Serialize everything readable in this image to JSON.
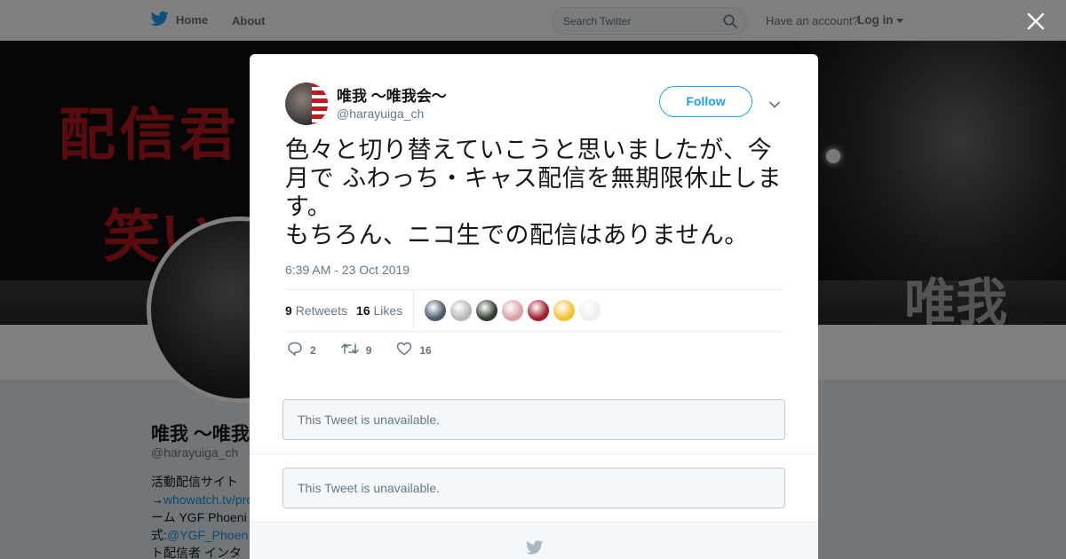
{
  "nav": {
    "home_label": "Home",
    "about_label": "About",
    "search_placeholder": "Search Twitter",
    "account_text": "Have an account?",
    "login_label": "Log in"
  },
  "background_profile": {
    "banner_text_1": "配信君",
    "banner_text_2": "笑い",
    "banner_label": "唯我",
    "name": "唯我 ～唯我",
    "handle": "@harayuiga_ch",
    "bio_line_1": "活動配信サイト",
    "bio_line_2_prefix": "→",
    "bio_line_2_link": "whowatch.tv/pro",
    "bio_line_3": "ーム YGF Phoeni",
    "bio_line_4_prefix": "式:",
    "bio_line_4_link": "@YGF_Phoen",
    "bio_line_5": "ト配信者 インタ"
  },
  "tweet": {
    "author_name": "唯我 ～唯我会～",
    "author_handle": "@harayuiga_ch",
    "follow_label": "Follow",
    "text": "色々と切り替えていこうと思いましたが、今月で ふわっち・キャス配信を無期限休止します。\nもちろん、ニコ生での配信はありません。",
    "timestamp": "6:39 AM - 23 Oct 2019",
    "retweets_count": "9",
    "retweets_label": "Retweets",
    "likes_count": "16",
    "likes_label": "Likes",
    "reply_count": "2",
    "retweet_action_count": "9",
    "like_action_count": "16",
    "liker_faces": [
      "#4a5a6a",
      "#b7b7b7",
      "#2f3b2d",
      "#d9a0a6",
      "#a11c2a",
      "#f1c232",
      "#eeeeee",
      "#ffffff"
    ]
  },
  "unavailable_1": "This Tweet is unavailable.",
  "unavailable_2": "This Tweet is unavailable.",
  "colors": {
    "accent": "#1da1f2",
    "secondary_text": "#657786"
  }
}
